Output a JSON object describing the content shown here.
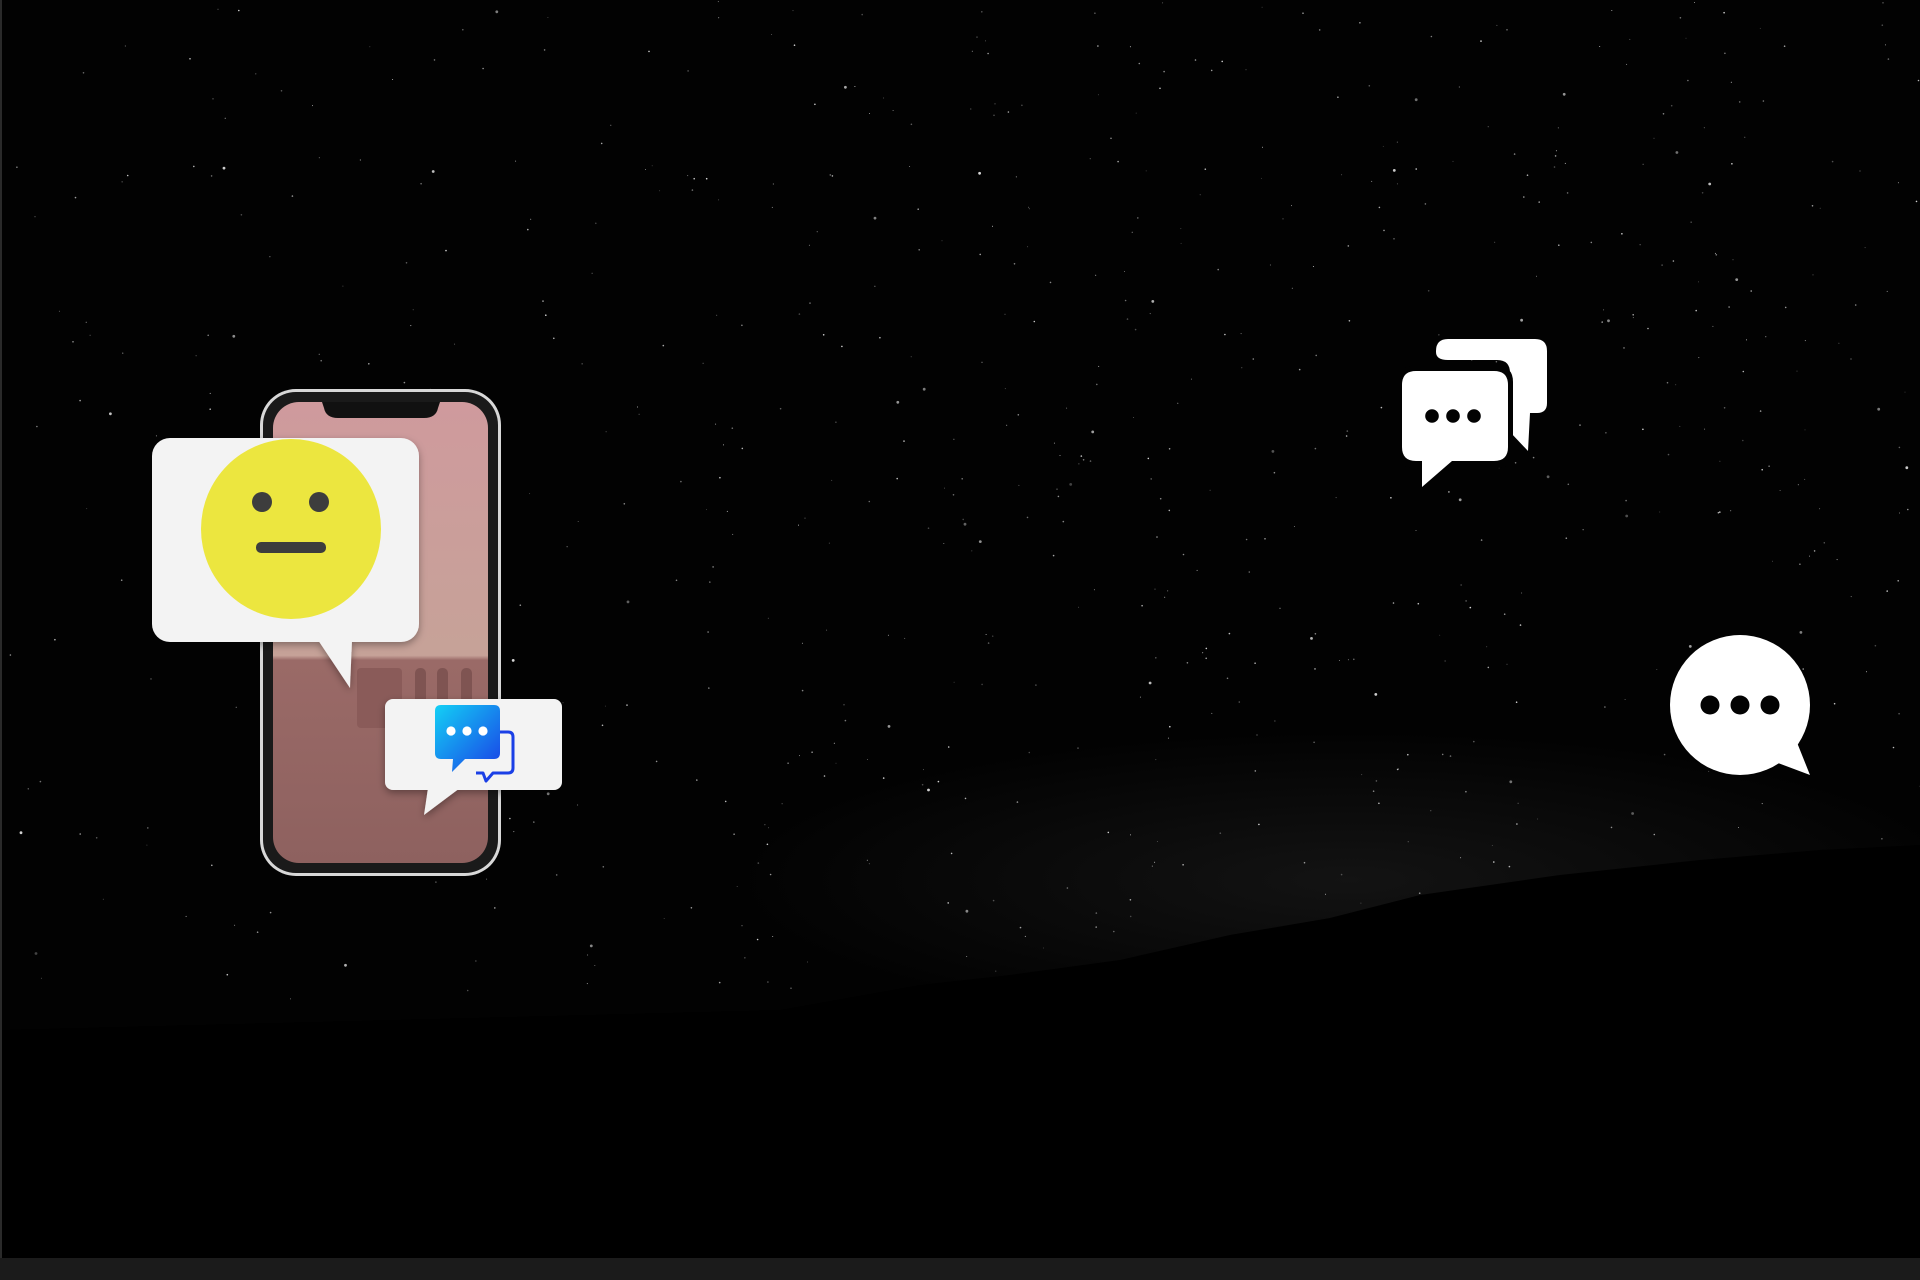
{
  "scene": {
    "background_color": "#020202",
    "star_color": "#ffffff",
    "horizon_glow_color": "#3a3a3a",
    "bottom_strip_color": "#1b1b1b"
  },
  "phone": {
    "frame_color": "#c9c9c9",
    "screen_top_color": "#cf9a9d",
    "screen_bottom_color": "#8e615f"
  },
  "emoji_bubble": {
    "icon": "neutral-face-icon",
    "bubble_color": "#f3f3f3",
    "face_color": "#ece63f",
    "feature_color": "#3d3d3d"
  },
  "chat_bubble": {
    "icon": "chat-bubbles-gradient-icon",
    "bubble_color": "#f3f3f3",
    "gradient_start": "#13d0f5",
    "gradient_end": "#1a3fe6"
  },
  "floating_icons": [
    {
      "icon": "double-chat-bubbles-icon",
      "color": "#ffffff"
    },
    {
      "icon": "round-chat-bubble-icon",
      "color": "#ffffff"
    }
  ]
}
